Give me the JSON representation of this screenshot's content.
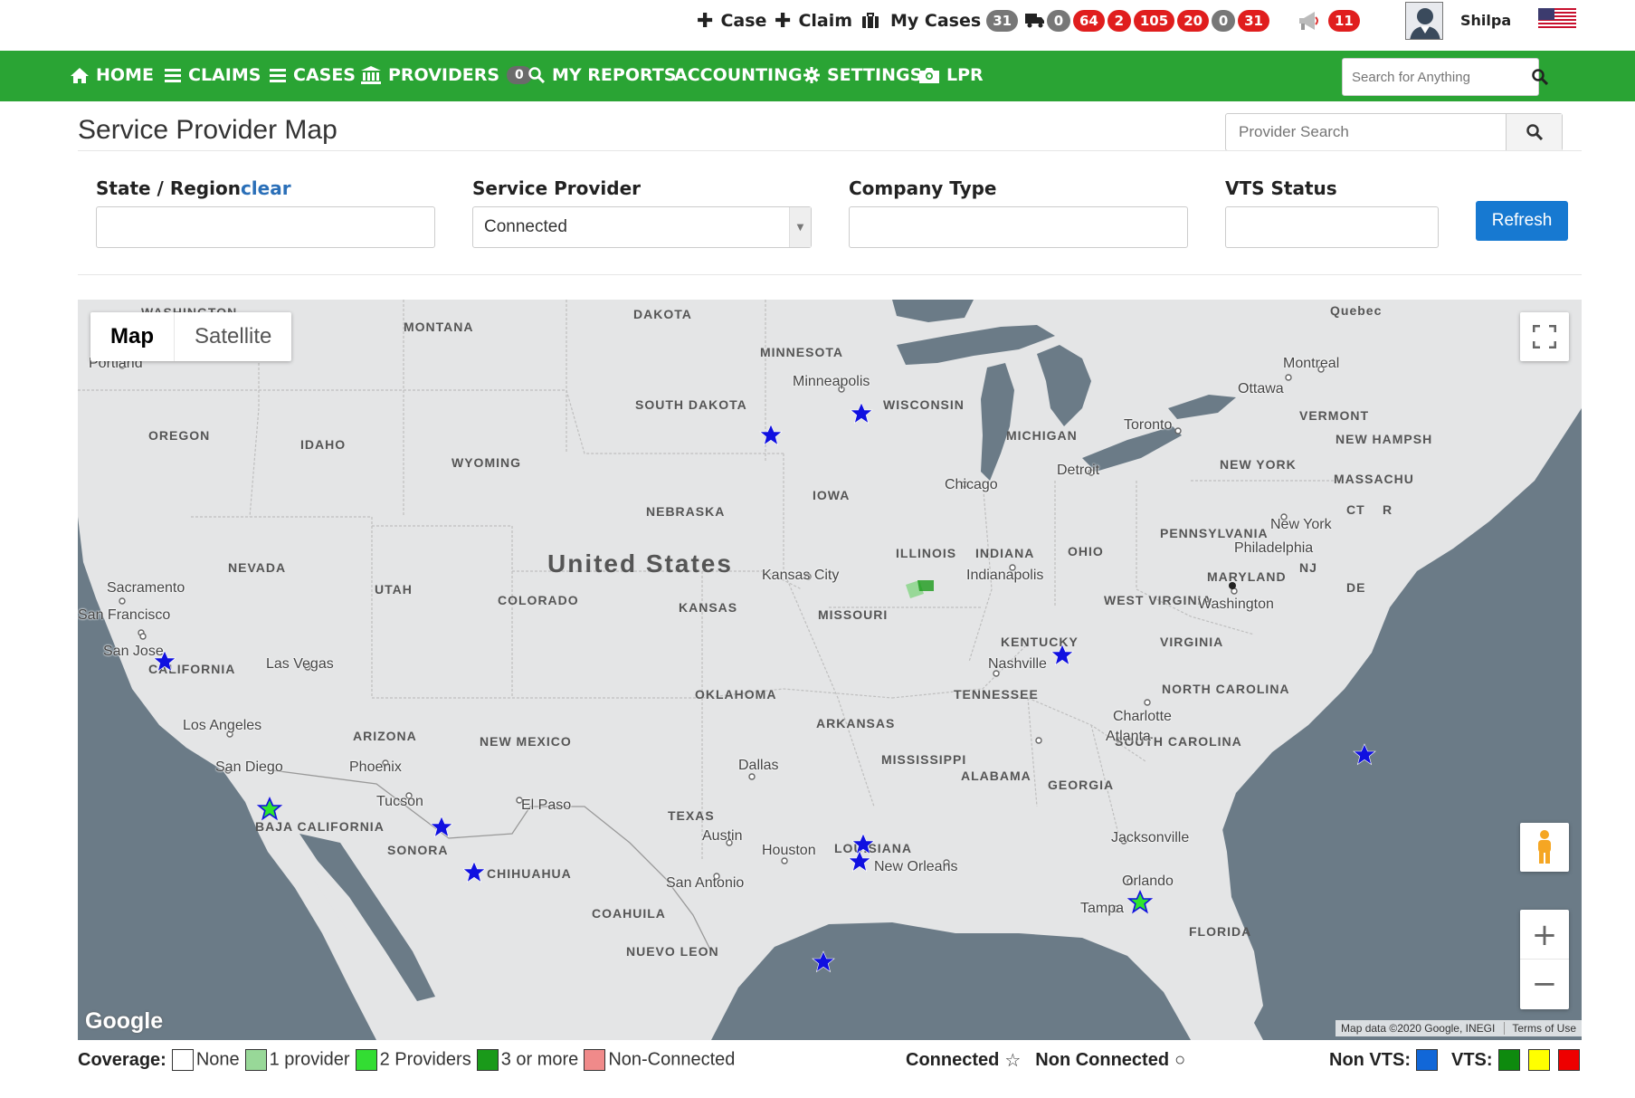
{
  "topbar": {
    "case_label": "Case",
    "claim_label": "Claim",
    "my_cases_label": "My Cases",
    "my_cases_count": "31",
    "status_counts": [
      {
        "value": "0",
        "color": "grey"
      },
      {
        "value": "64",
        "color": "red"
      },
      {
        "value": "2",
        "color": "red"
      },
      {
        "value": "105",
        "color": "red"
      },
      {
        "value": "20",
        "color": "red"
      },
      {
        "value": "0",
        "color": "grey"
      },
      {
        "value": "31",
        "color": "red"
      }
    ],
    "alerts_count": "11",
    "user_name": "Shilpa"
  },
  "nav": {
    "home": "HOME",
    "claims": "CLAIMS",
    "cases": "CASES",
    "providers": "PROVIDERS",
    "providers_count": "0",
    "my_reports": "MY REPORTS",
    "accounting": "ACCOUNTING",
    "settings": "SETTINGS",
    "lpr": "LPR",
    "search_placeholder": "Search for Anything"
  },
  "page": {
    "title": "Service Provider Map",
    "provider_search_placeholder": "Provider Search"
  },
  "filters": {
    "state_label": "State / Region",
    "state_clear": "clear",
    "state_value": "",
    "provider_label": "Service Provider",
    "provider_value": "Connected",
    "company_type_label": "Company Type",
    "company_type_value": "",
    "vts_label": "VTS Status",
    "vts_value": "",
    "refresh_label": "Refresh"
  },
  "map": {
    "map_tab": "Map",
    "satellite_tab": "Satellite",
    "google_logo": "Google",
    "attribution": "Map data ©2020 Google, INEGI",
    "terms": "Terms of Use",
    "colors": {
      "land": "#e4e5e6",
      "water": "#6b7b87",
      "connected_star": "#1010e0",
      "vts_star": "#2ee52e"
    },
    "labels": {
      "country": "United States",
      "states": [
        "WASHINGTON",
        "MONTANA",
        "DAKOTA",
        "MINNESOTA",
        "SOUTH DAKOTA",
        "WISCONSIN",
        "MICHIGAN",
        "OREGON",
        "IDAHO",
        "WYOMING",
        "IOWA",
        "NEBRASKA",
        "NEVADA",
        "UTAH",
        "COLORADO",
        "KANSAS",
        "MISSOURI",
        "ILLINOIS",
        "INDIANA",
        "OHIO",
        "PENNSYLVANIA",
        "NEW YORK",
        "VERMONT",
        "NEW HAMPSH",
        "MASSACHU",
        "CT",
        "R",
        "NJ",
        "MARYLAND",
        "DE",
        "WEST VIRGINIA",
        "VIRGINIA",
        "KENTUCKY",
        "CALIFORNIA",
        "ARIZONA",
        "NEW MEXICO",
        "OKLAHOMA",
        "ARKANSAS",
        "TENNESSEE",
        "NORTH CAROLINA",
        "SOUTH CAROLINA",
        "MISSISSIPPI",
        "ALABAMA",
        "GEORGIA",
        "TEXAS",
        "LOUISIANA",
        "FLORIDA",
        "BAJA CALIFORNIA",
        "SONORA",
        "CHIHUAHUA",
        "COAHUILA",
        "NUEVO LEON",
        "Quebec"
      ],
      "cities": [
        "Portland",
        "Minneapolis",
        "Montreal",
        "Ottawa",
        "Toronto",
        "Detroit",
        "Chicago",
        "Sacramento",
        "San Francisco",
        "San Jose",
        "Las Vegas",
        "Kansas City",
        "Indianapolis",
        "New York",
        "Philadelphia",
        "Washington",
        "Nashville",
        "Charlotte",
        "Los Angeles",
        "San Diego",
        "Phoenix",
        "Tucson",
        "El Paso",
        "Dallas",
        "Austin",
        "Houston",
        "San Antonio",
        "Atlanta",
        "New Orleans",
        "Jacksonville",
        "Orlando",
        "Tampa"
      ]
    }
  },
  "legend": {
    "coverage_label": "Coverage:",
    "coverage_items": [
      {
        "label": "None",
        "color": "#ffffff"
      },
      {
        "label": "1 provider",
        "color": "#98d898"
      },
      {
        "label": "2 Providers",
        "color": "#33dd33"
      },
      {
        "label": "3 or more",
        "color": "#1a9a1a"
      },
      {
        "label": "Non-Connected",
        "color": "#f08a8a"
      }
    ],
    "connected_label": "Connected",
    "non_connected_label": "Non Connected",
    "non_vts_label": "Non VTS:",
    "non_vts_color": "#1167d8",
    "vts_label": "VTS:",
    "vts_colors": [
      "#0e8a0e",
      "#ffff00",
      "#ee0000"
    ]
  }
}
